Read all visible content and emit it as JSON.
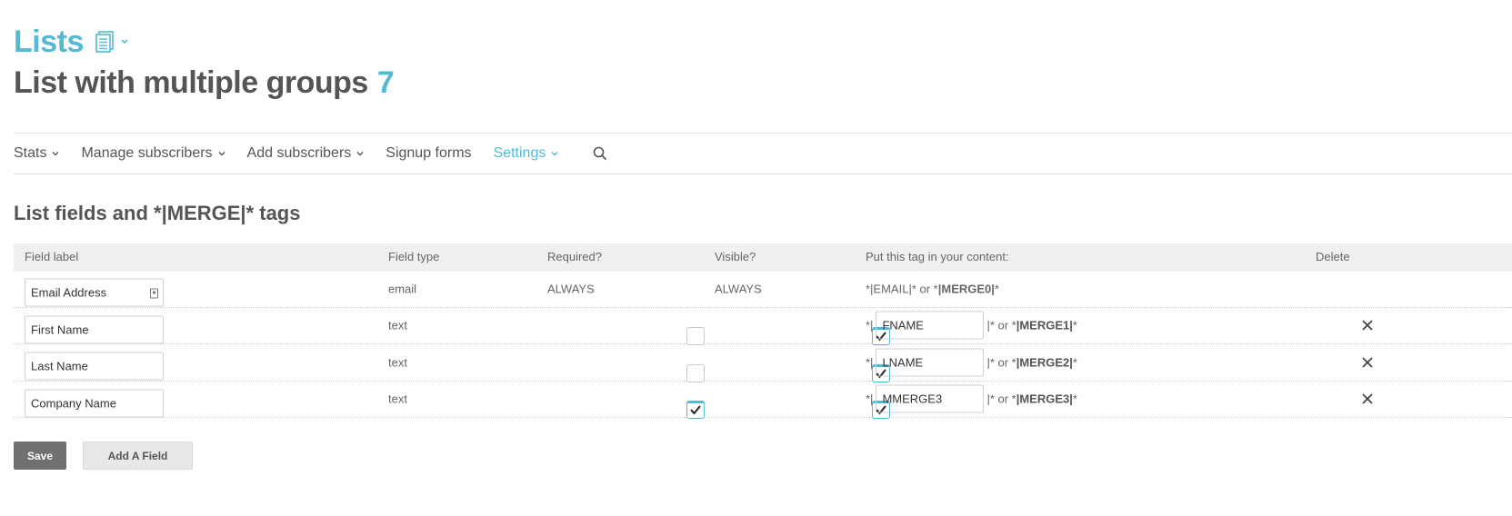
{
  "header": {
    "breadcrumb": "Lists",
    "list_name": "List with multiple groups",
    "list_count": "7"
  },
  "nav": {
    "items": [
      {
        "label": "Stats",
        "has_menu": true
      },
      {
        "label": "Manage subscribers",
        "has_menu": true
      },
      {
        "label": "Add subscribers",
        "has_menu": true
      },
      {
        "label": "Signup forms",
        "has_menu": false
      },
      {
        "label": "Settings",
        "has_menu": true,
        "active": true
      }
    ],
    "search_icon": "search-icon"
  },
  "section": {
    "title": "List fields and *|MERGE|* tags"
  },
  "table": {
    "headers": {
      "label": "Field label",
      "type": "Field type",
      "required": "Required?",
      "visible": "Visible?",
      "tag": "Put this tag in your content:",
      "delete": "Delete"
    },
    "rows": [
      {
        "label": "Email Address",
        "type": "email",
        "required": "ALWAYS",
        "visible": "ALWAYS",
        "tag_text": "*|EMAIL|* or *",
        "merge_tag": "|MERGE0|",
        "tag_suffix": "*"
      },
      {
        "label": "First Name",
        "type": "text",
        "required": false,
        "visible": true,
        "tag_prefix": "*|",
        "tag_value": "FNAME",
        "tag_mid": "|* or *",
        "merge_tag": "|MERGE1|",
        "tag_suffix": "*"
      },
      {
        "label": "Last Name",
        "type": "text",
        "required": false,
        "visible": true,
        "tag_prefix": "*|",
        "tag_value": "LNAME",
        "tag_mid": "|* or *",
        "merge_tag": "|MERGE2|",
        "tag_suffix": "*"
      },
      {
        "label": "Company Name",
        "type": "text",
        "required": true,
        "visible": true,
        "tag_prefix": "*|",
        "tag_value": "MMERGE3",
        "tag_mid": "|* or *",
        "merge_tag": "|MERGE3|",
        "tag_suffix": "*"
      }
    ]
  },
  "actions": {
    "save": "Save",
    "add_field": "Add A Field"
  },
  "colors": {
    "accent": "#52bad5",
    "text": "#555555",
    "save_bg": "#707070"
  }
}
